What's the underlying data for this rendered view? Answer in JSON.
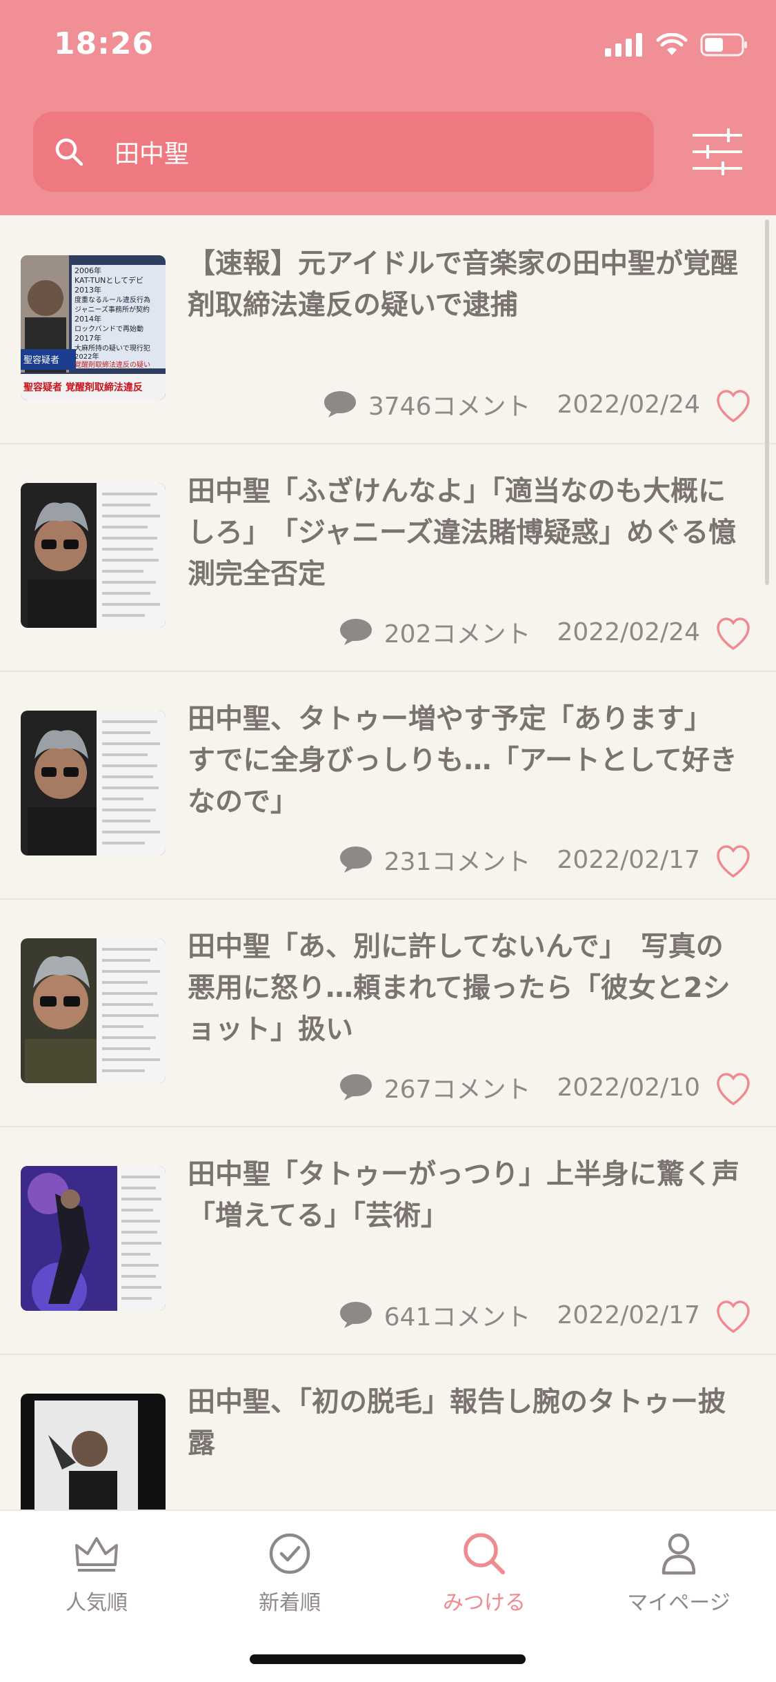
{
  "status_bar": {
    "time": "18:26"
  },
  "search": {
    "query": "田中聖"
  },
  "articles": [
    {
      "title": "【速報】元アイドルで音楽家の田中聖が覚醒剤取締法違反の疑いで逮捕",
      "comments": "3746コメント",
      "date": "2022/02/24"
    },
    {
      "title": "田中聖「ふざけんなよ」「適当なのも大概にしろ」　「ジャニーズ違法賭博疑惑」めぐる憶測完全否定",
      "comments": "202コメント",
      "date": "2022/02/24"
    },
    {
      "title": "田中聖、タトゥー増やす予定「あります」　すでに全身びっしりも…「アートとして好きなので」",
      "comments": "231コメント",
      "date": "2022/02/17"
    },
    {
      "title": "田中聖「あ、別に許してないんで」　写真の悪用に怒り…頼まれて撮ったら「彼女と2ショット」扱い",
      "comments": "267コメント",
      "date": "2022/02/10"
    },
    {
      "title": "田中聖「タトゥーがっつり」上半身に驚く声　「増えてる」「芸術」",
      "comments": "641コメント",
      "date": "2022/02/17"
    },
    {
      "title": "田中聖、「初の脱毛」報告し腕のタトゥー披露",
      "comments": "",
      "date": ""
    }
  ],
  "thumb1_text": {
    "rows": [
      "2006年",
      "KAT-TUNとしてデビ",
      "2013年",
      "度重なるルール違反行為",
      "ジャニーズ事務所が契約",
      "2014年",
      "ロックバンドで再始動",
      "2017年",
      "大麻所持の疑いで現行犯",
      "2022年",
      "覚醒剤取締法違反の疑い"
    ],
    "name": "聖容疑者",
    "caption": "聖容疑者 覚醒剤取締法違反"
  },
  "tabs": [
    {
      "label": "人気順",
      "icon": "crown-icon"
    },
    {
      "label": "新着順",
      "icon": "clock-icon"
    },
    {
      "label": "みつける",
      "icon": "search-icon"
    },
    {
      "label": "マイページ",
      "icon": "person-icon"
    }
  ],
  "colors": {
    "header": "#f08f95",
    "search_field": "#ee7981",
    "accent": "#ef8a90",
    "background": "#f7f4ee"
  }
}
